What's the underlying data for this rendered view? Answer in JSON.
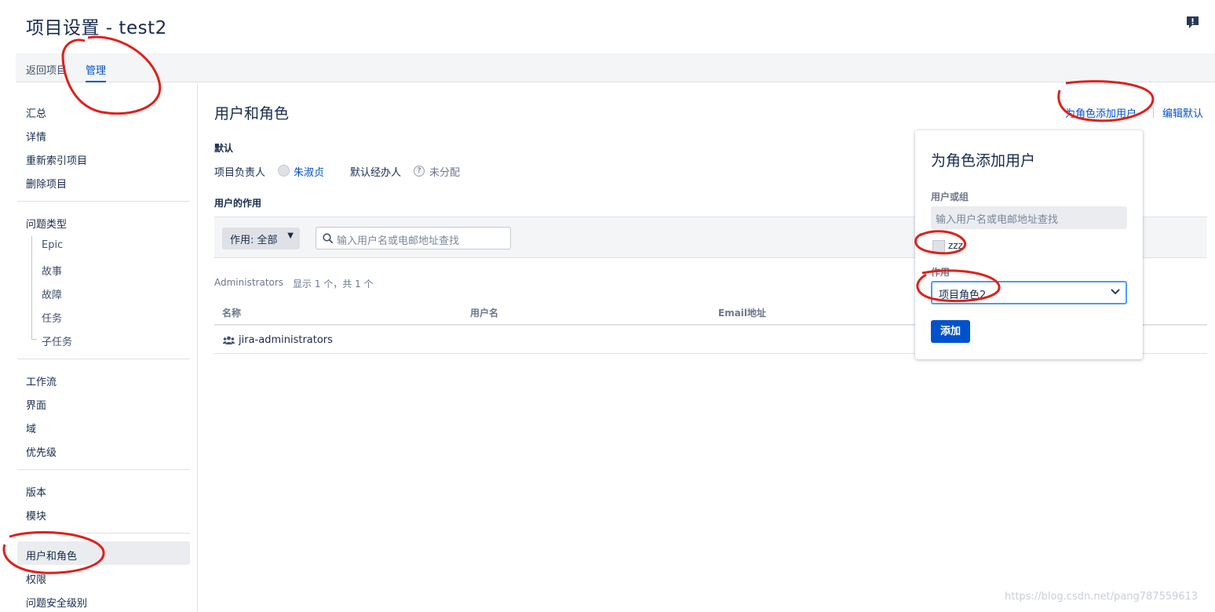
{
  "header": {
    "title": "项目设置 - test2"
  },
  "tabs": {
    "back": "返回项目",
    "admin": "管理"
  },
  "sidebar": {
    "items": [
      "汇总",
      "详情",
      "重新索引项目",
      "删除项目",
      "问题类型",
      "Epic",
      "故事",
      "故障",
      "任务",
      "子任务",
      "工作流",
      "界面",
      "域",
      "优先级",
      "版本",
      "模块",
      "用户和角色",
      "权限",
      "问题安全级别"
    ],
    "active": "用户和角色"
  },
  "main": {
    "title": "用户和角色",
    "actions": {
      "add_user_to_role": "为角色添加用户",
      "edit_defaults": "编辑默认"
    },
    "defaults": {
      "section_label": "默认",
      "lead_label": "项目负责人",
      "lead_value": "朱淑贞",
      "assignee_label": "默认经办人",
      "assignee_value": "未分配"
    },
    "roles": {
      "section_label": "用户的作用",
      "role_filter": "作用: 全部",
      "search_placeholder": "输入用户名或电邮地址查找"
    },
    "group": {
      "name": "Administrators",
      "count": "显示 1 个，共 1 个"
    },
    "table": {
      "headers": [
        "名称",
        "用户名",
        "Email地址"
      ],
      "rows": [
        {
          "name": "jira-administrators"
        }
      ]
    }
  },
  "dialog": {
    "title": "为角色添加用户",
    "user_label": "用户或组",
    "user_placeholder": "输入用户名或电邮地址查找",
    "selected_user": "zzz",
    "role_label": "作用",
    "role_value": "项目角色2",
    "submit_label": "添加"
  },
  "watermark": "https://blog.csdn.net/pang787559613",
  "colors": {
    "accent": "#0052cc",
    "annotation": "#e0201b"
  }
}
